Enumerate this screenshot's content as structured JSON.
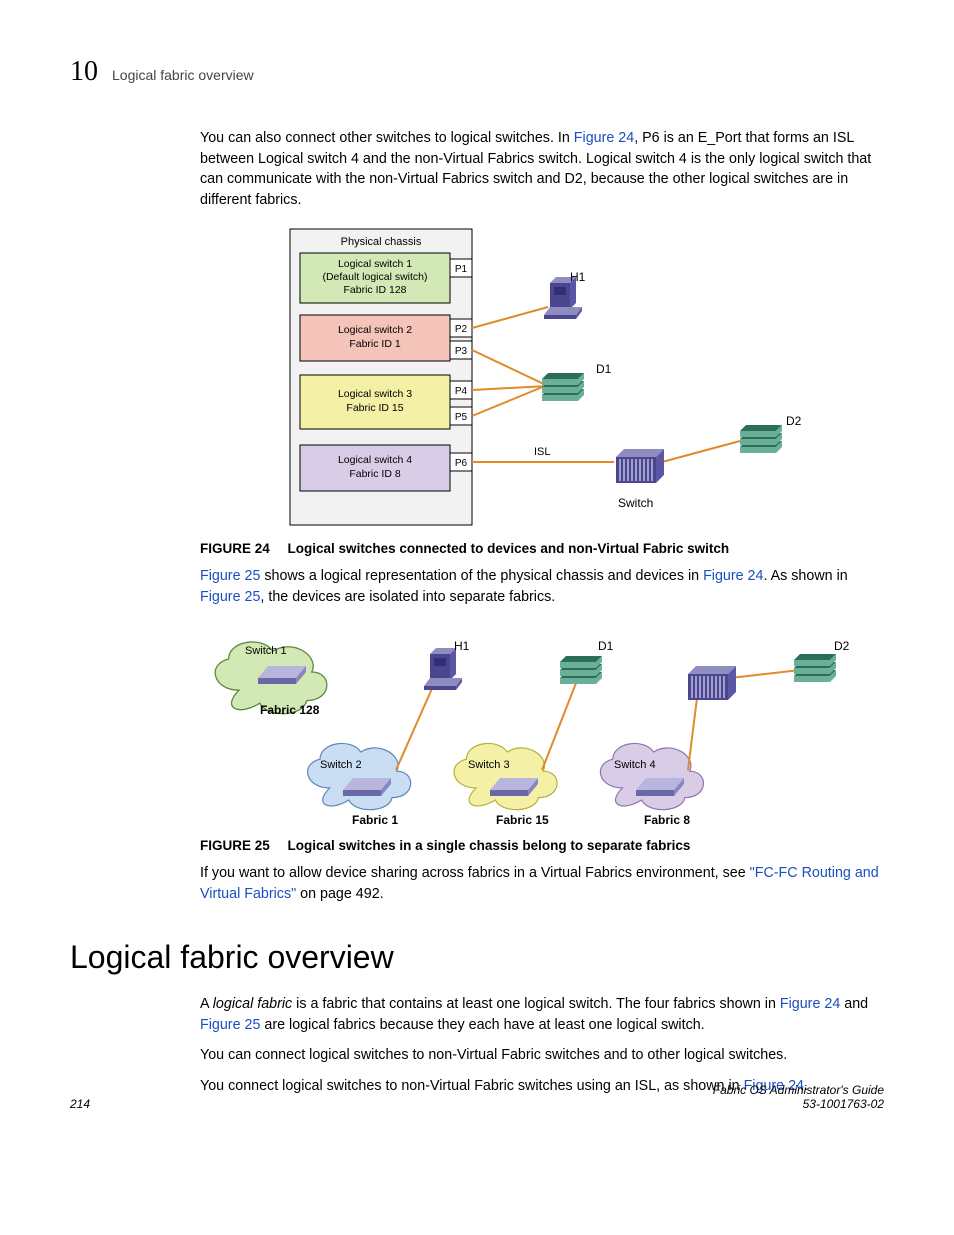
{
  "header": {
    "chapter_number": "10",
    "title": "Logical fabric overview"
  },
  "para1": {
    "t1": "You can also connect other switches to logical switches. In ",
    "link1": "Figure 24",
    "t2": ", P6 is an E_Port that forms an ISL between Logical switch 4 and the non-Virtual Fabrics switch. Logical switch 4 is the only logical switch that can communicate with the non-Virtual Fabrics switch and D2, because the other logical switches are in different fabrics."
  },
  "fig24": {
    "label": "FIGURE 24",
    "caption": "Logical switches connected to devices and non-Virtual Fabric switch",
    "chassis_title": "Physical chassis",
    "ls1_l1": "Logical switch 1",
    "ls1_l2": "(Default logical switch)",
    "ls1_l3": "Fabric ID 128",
    "ls2_l1": "Logical switch 2",
    "ls2_l2": "Fabric ID 1",
    "ls3_l1": "Logical switch 3",
    "ls3_l2": "Fabric ID 15",
    "ls4_l1": "Logical switch 4",
    "ls4_l2": "Fabric ID 8",
    "p1": "P1",
    "p2": "P2",
    "p3": "P3",
    "p4": "P4",
    "p5": "P5",
    "p6": "P6",
    "h1": "H1",
    "d1": "D1",
    "d2": "D2",
    "isl": "ISL",
    "switch": "Switch"
  },
  "para2": {
    "link1": "Figure 25",
    "t1": " shows a logical representation of the physical chassis and devices in ",
    "link2": "Figure 24",
    "t2": ". As shown in ",
    "link3": "Figure 25",
    "t3": ", the devices are isolated into separate fabrics."
  },
  "fig25": {
    "label": "FIGURE 25",
    "caption": "Logical switches in a single chassis belong to separate fabrics",
    "sw1": "Switch 1",
    "sw2": "Switch 2",
    "sw3": "Switch 3",
    "sw4": "Switch 4",
    "h1": "H1",
    "d1": "D1",
    "d2": "D2",
    "f128": "Fabric 128",
    "f1": "Fabric 1",
    "f15": "Fabric 15",
    "f8": "Fabric 8"
  },
  "para3": {
    "t1": "If you want to allow device sharing across fabrics in a Virtual Fabrics environment, see ",
    "link1": "\"FC-FC Routing and Virtual Fabrics\"",
    "t2": " on page 492."
  },
  "heading": "Logical fabric overview",
  "para4": {
    "t1": "A ",
    "em": "logical fabric",
    "t2": " is a fabric that contains at least one logical switch. The four fabrics shown in ",
    "link1": "Figure 24",
    "t3": " and ",
    "link2": "Figure 25",
    "t4": " are logical fabrics because they each have at least one logical switch."
  },
  "para5": "You can connect logical switches to non-Virtual Fabric switches and to other logical switches.",
  "para6": {
    "t1": "You connect logical switches to non-Virtual Fabric switches using an ISL, as shown in ",
    "link1": "Figure 24",
    "t2": "."
  },
  "footer": {
    "page": "214",
    "book": "Fabric OS Administrator's Guide",
    "docnum": "53-1001763-02"
  },
  "colors": {
    "ls_green": "#d3e9b5",
    "ls_pink": "#f4c3b9",
    "ls_yellow": "#f4f0a5",
    "ls_lilac": "#d9cce6",
    "cloud_pink": "#f4c3b9",
    "cloud_blue": "#c9def2",
    "cloud_yellow": "#f4f0a5",
    "cloud_lilac": "#d9cce6",
    "teal_dark": "#2d6e5a",
    "teal_light": "#6ab096",
    "purple_dark": "#4a4790",
    "purple_light": "#8f8cc0",
    "orange": "#e28a2a"
  }
}
